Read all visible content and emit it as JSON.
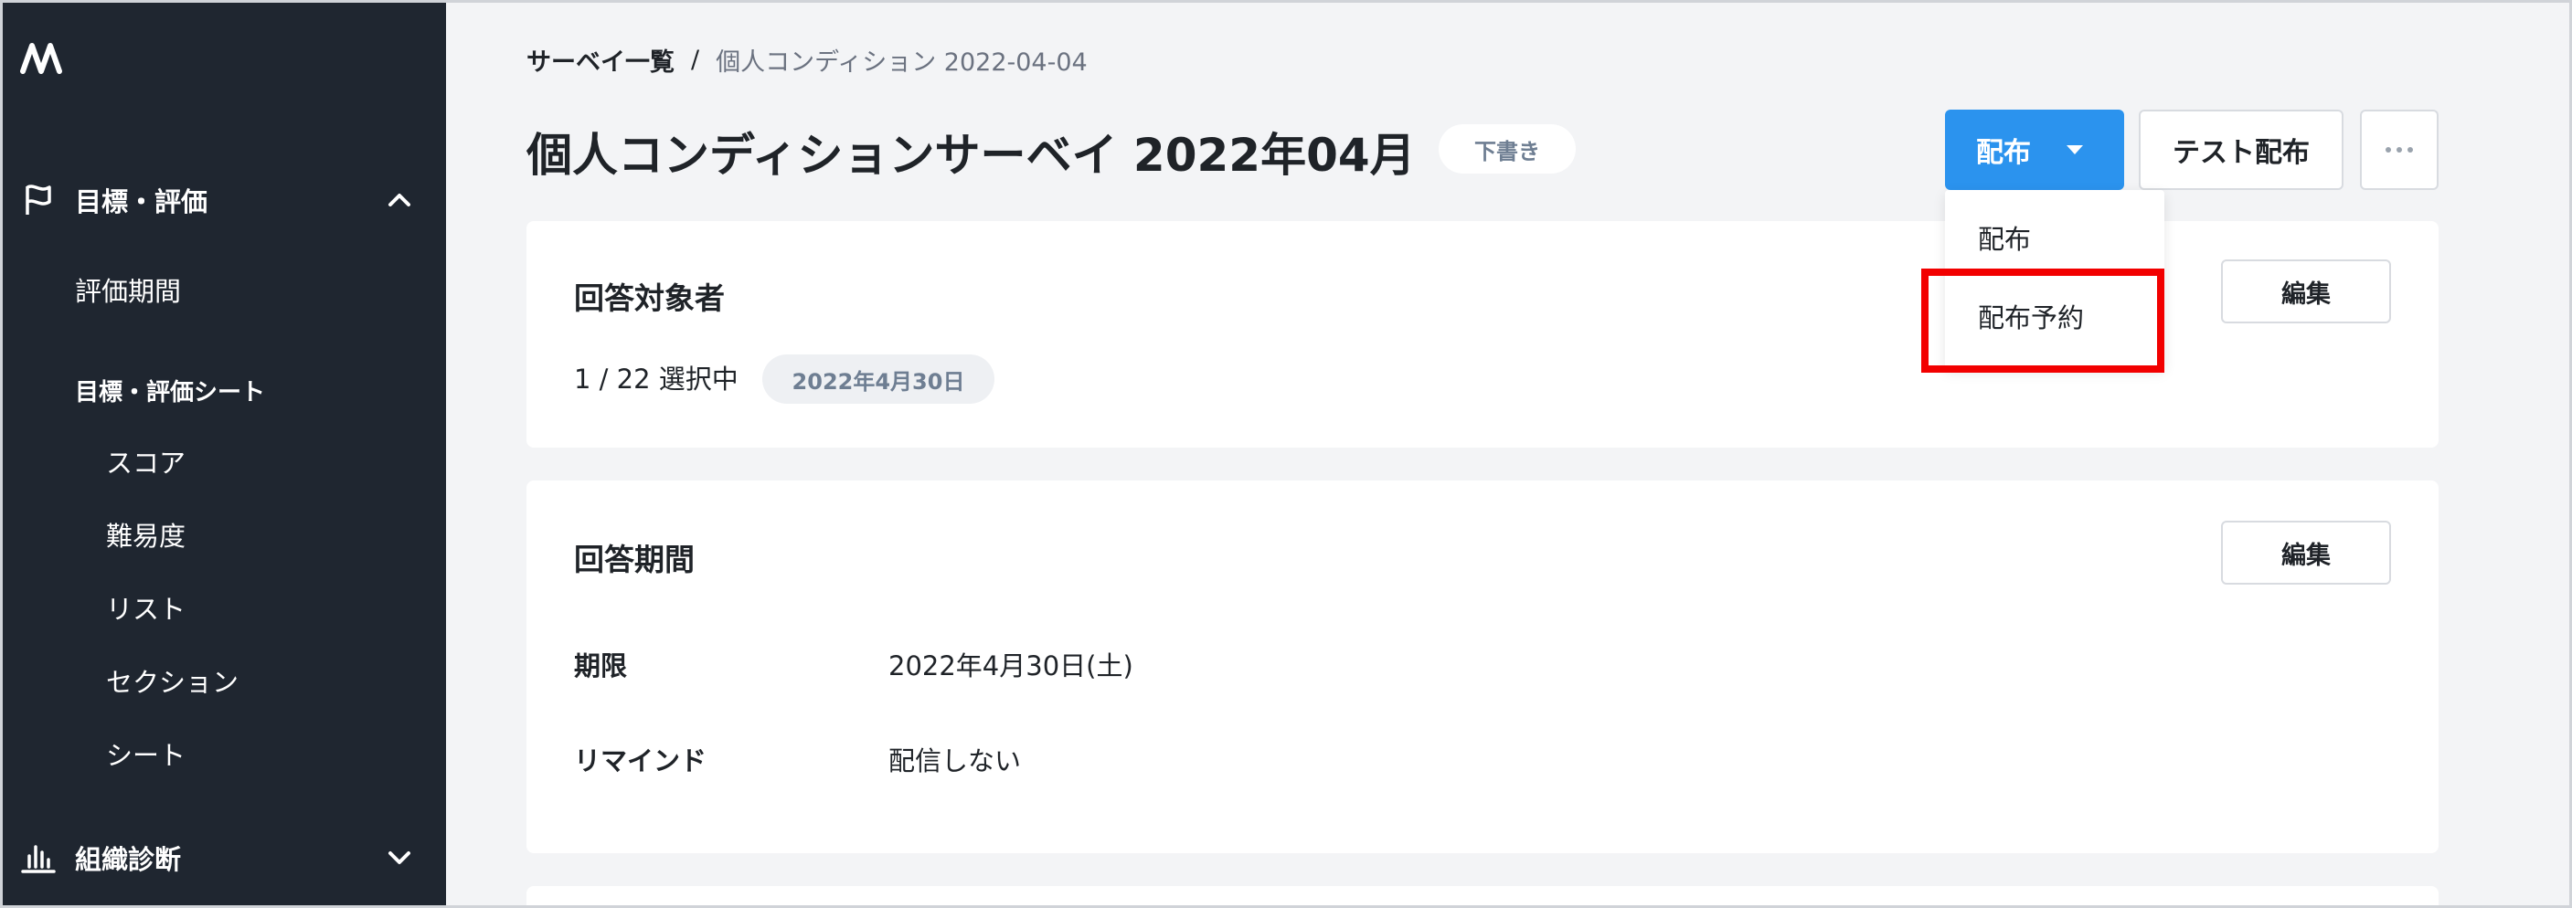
{
  "sidebar": {
    "logo": "logo-icon",
    "groups": [
      {
        "label": "目標・評価",
        "icon": "flag-icon",
        "expanded": true
      },
      {
        "label": "組織診断",
        "icon": "bar-chart-icon",
        "expanded": false
      }
    ],
    "items": [
      {
        "label": "評価期間"
      },
      {
        "label": "目標・評価シート"
      },
      {
        "label": "スコア"
      },
      {
        "label": "難易度"
      },
      {
        "label": "リスト"
      },
      {
        "label": "セクション"
      },
      {
        "label": "シート"
      }
    ]
  },
  "breadcrumb": {
    "parent": "サーベイ一覧",
    "separator": "/",
    "current": "個人コンディション 2022-04-04"
  },
  "header": {
    "title": "個人コンディションサーベイ 2022年04月",
    "status": "下書き",
    "distribute_label": "配布",
    "test_distribute_label": "テスト配布",
    "more_icon": "more-horizontal-icon"
  },
  "dropdown": {
    "items": [
      {
        "label": "配布"
      },
      {
        "label": "配布予約",
        "highlighted": true
      }
    ],
    "highlight_color": "#f20000"
  },
  "respondents_card": {
    "title": "回答対象者",
    "edit_label": "編集",
    "selection": "1 / 22 選択中",
    "date_badge": "2022年4月30日"
  },
  "period_card": {
    "title": "回答期間",
    "edit_label": "編集",
    "rows": [
      {
        "label": "期限",
        "value": "2022年4月30日(土)"
      },
      {
        "label": "リマインド",
        "value": "配信しない"
      }
    ]
  },
  "colors": {
    "sidebar_bg": "#1f2630",
    "primary": "#2b93ee",
    "page_bg": "#f3f4f6"
  }
}
